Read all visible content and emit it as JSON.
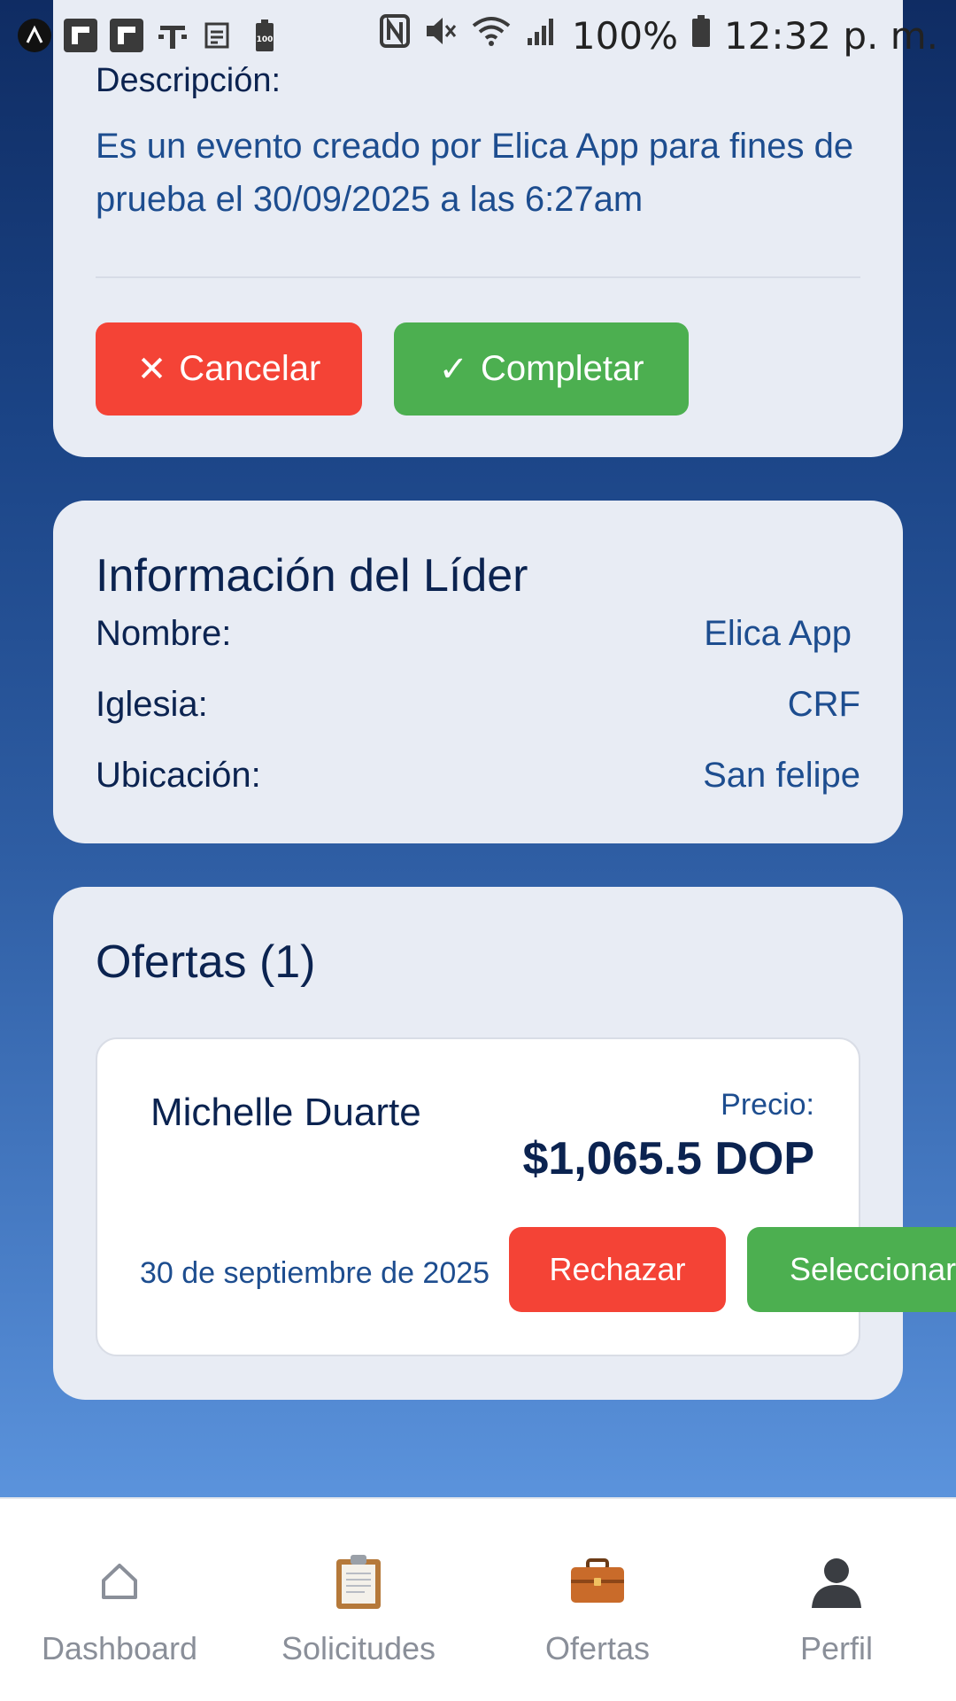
{
  "status_bar": {
    "battery": "100%",
    "time": "12:32 p. m.",
    "battery_small": "100"
  },
  "event": {
    "description_label": "Descripción:",
    "description_text": "Es un evento creado por Elica App para fines de prueba el 30/09/2025 a las 6:27am",
    "cancel_label": "Cancelar",
    "complete_label": "Completar"
  },
  "leader": {
    "title": "Información del Líder",
    "rows": [
      {
        "label": "Nombre:",
        "value": "Elica App"
      },
      {
        "label": "Iglesia:",
        "value": "CRF"
      },
      {
        "label": "Ubicación:",
        "value": "San felipe"
      }
    ]
  },
  "offers": {
    "title": "Ofertas (1)",
    "items": [
      {
        "name": "Michelle Duarte",
        "price_label": "Precio:",
        "price": "$1,065.5 DOP",
        "date": "30 de septiembre de 2025",
        "reject_label": "Rechazar",
        "select_label": "Seleccionar"
      }
    ]
  },
  "nav": [
    {
      "label": "Dashboard",
      "icon": "home-icon"
    },
    {
      "label": "Solicitudes",
      "icon": "clipboard-icon"
    },
    {
      "label": "Ofertas",
      "icon": "briefcase-icon"
    },
    {
      "label": "Perfil",
      "icon": "user-silhouette-icon"
    }
  ],
  "colors": {
    "cancel": "#f44336",
    "complete": "#4caf50",
    "card_bg": "#e8ecf4",
    "text_dark": "#0b2350",
    "text_blue": "#1d4d8f"
  }
}
